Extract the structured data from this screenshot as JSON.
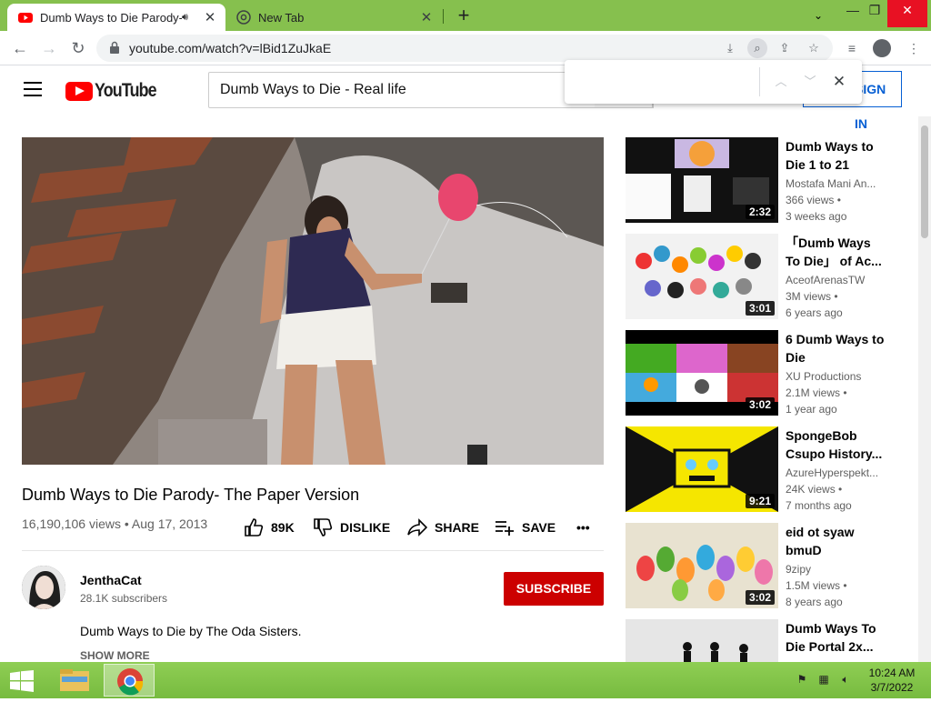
{
  "browser": {
    "tabs": [
      {
        "title": "Dumb Ways to Die Parody- T",
        "active": true,
        "audio": true
      },
      {
        "title": "New Tab",
        "active": false
      }
    ],
    "url": "youtube.com/watch?v=lBid1ZuJkaE"
  },
  "find_bar": {
    "value": ""
  },
  "youtube": {
    "logo_text": "YouTube",
    "search_value": "Dumb Ways to Die - Real life",
    "sign_in": "SIGN IN",
    "video": {
      "title": "Dumb Ways to Die Parody- The Paper Version",
      "views": "16,190,106 views",
      "separator": "•",
      "date": "Aug 17, 2013",
      "likes": "89K",
      "dislike": "DISLIKE",
      "share": "SHARE",
      "save": "SAVE",
      "channel": "JenthaCat",
      "subscribers": "28.1K subscribers",
      "subscribe": "SUBSCRIBE",
      "description": "Dumb Ways to Die by The Oda Sisters.",
      "show_more": "SHOW MORE"
    },
    "recommendations": [
      {
        "title": "Dumb Ways to Die 1 to 21",
        "channel": "Mostafa Mani An...",
        "views": "366 views •",
        "age": "3 weeks ago",
        "duration": "2:32"
      },
      {
        "title": "「Dumb Ways To Die」 of Ac...",
        "channel": "AceofArenasTW",
        "views": "3M views •",
        "age": "6 years ago",
        "duration": "3:01"
      },
      {
        "title": "6 Dumb Ways to Die",
        "channel": "XU Productions",
        "views": "2.1M views •",
        "age": "1 year ago",
        "duration": "3:02"
      },
      {
        "title": "SpongeBob Csupo History...",
        "channel": "AzureHyperspekt...",
        "views": "24K views •",
        "age": "7 months ago",
        "duration": "9:21"
      },
      {
        "title": "eid ot syaw bmuD",
        "channel": "9zipy",
        "views": "1.5M views •",
        "age": "8 years ago",
        "duration": "3:02"
      },
      {
        "title": "Dumb Ways To Die Portal 2x...",
        "channel": "",
        "views": "",
        "age": "",
        "duration": ""
      }
    ]
  },
  "taskbar": {
    "time": "10:24 AM",
    "date": "3/7/2022"
  },
  "colors": {
    "chrome_frame": "#86c04e",
    "yt_red": "#ff0000",
    "subscribe_red": "#cc0000",
    "link_blue": "#065fd4"
  }
}
